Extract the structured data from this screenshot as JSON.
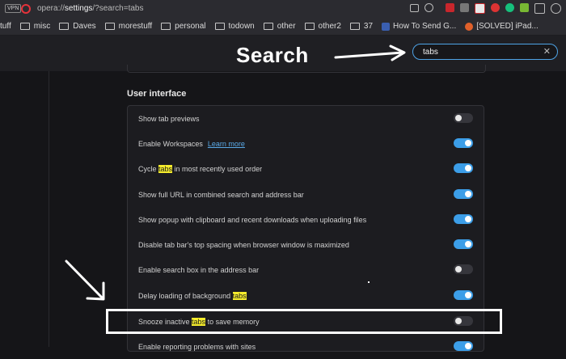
{
  "browser": {
    "vpn_label": "VPN",
    "url_prefix": "opera://",
    "url_path": "settings",
    "url_query": "/?search=tabs",
    "bookmarks": [
      {
        "label": "tuff",
        "type": "text"
      },
      {
        "label": "misc",
        "type": "folder"
      },
      {
        "label": "Daves",
        "type": "folder"
      },
      {
        "label": "morestuff",
        "type": "folder"
      },
      {
        "label": "personal",
        "type": "folder"
      },
      {
        "label": "todown",
        "type": "folder"
      },
      {
        "label": "other",
        "type": "folder"
      },
      {
        "label": "other2",
        "type": "folder"
      },
      {
        "label": "37",
        "type": "folder"
      },
      {
        "label": "How To Send G...",
        "type": "site",
        "color": "#3a5fb0"
      },
      {
        "label": "[SOLVED] iPad...",
        "type": "site",
        "color": "#e0602a"
      }
    ]
  },
  "annotation": {
    "search_label": "Search",
    "arrow_color": "#ffffff"
  },
  "search": {
    "value": "tabs",
    "clear_icon": "close-icon"
  },
  "section": {
    "title": "User interface",
    "items": [
      {
        "pre": "Show tab previews",
        "hl": "",
        "post": "",
        "link": "",
        "on": false
      },
      {
        "pre": "Enable Workspaces",
        "hl": "",
        "post": "",
        "link": "Learn more",
        "on": true
      },
      {
        "pre": "Cycle ",
        "hl": "tabs",
        "post": " in most recently used order",
        "link": "",
        "on": true
      },
      {
        "pre": "Show full URL in combined search and address bar",
        "hl": "",
        "post": "",
        "link": "",
        "on": true
      },
      {
        "pre": "Show popup with clipboard and recent downloads when uploading files",
        "hl": "",
        "post": "",
        "link": "",
        "on": true
      },
      {
        "pre": "Disable tab bar's top spacing when browser window is maximized",
        "hl": "",
        "post": "",
        "link": "",
        "on": true
      },
      {
        "pre": "Enable search box in the address bar",
        "hl": "",
        "post": "",
        "link": "",
        "on": false
      },
      {
        "pre": "Delay loading of background ",
        "hl": "tabs",
        "post": "",
        "link": "",
        "on": true
      },
      {
        "pre": "Snooze inactive ",
        "hl": "tabs",
        "post": " to save memory",
        "link": "",
        "on": false
      },
      {
        "pre": "Enable reporting problems with sites",
        "hl": "",
        "post": "",
        "link": "",
        "on": true
      }
    ]
  },
  "colors": {
    "accent": "#3c9ee8",
    "highlight": "#f5ec2c",
    "background": "#151518"
  }
}
